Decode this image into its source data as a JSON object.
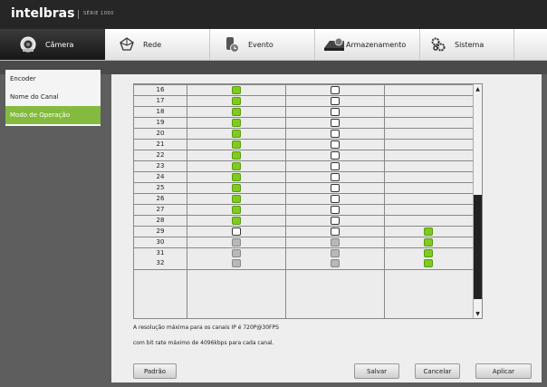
{
  "header": {
    "brand": "intelbras",
    "series": "SÉRIE 1000"
  },
  "tabs": [
    {
      "label": "Câmera",
      "icon": "camera-icon",
      "active": true
    },
    {
      "label": "Rede",
      "icon": "network-icon",
      "active": false
    },
    {
      "label": "Evento",
      "icon": "event-icon",
      "active": false
    },
    {
      "label": "Armazenamento",
      "icon": "storage-icon",
      "active": false
    },
    {
      "label": "Sistema",
      "icon": "system-gears-icon",
      "active": false
    }
  ],
  "sidebar": {
    "items": [
      {
        "label": "Encoder",
        "active": false
      },
      {
        "label": "Nome do Canal",
        "active": false
      },
      {
        "label": "Modo de Operação",
        "active": true
      }
    ]
  },
  "channel_rows": [
    {
      "channel": "16",
      "col1": "green",
      "col2": "white",
      "col3": "none"
    },
    {
      "channel": "17",
      "col1": "green",
      "col2": "white",
      "col3": "none"
    },
    {
      "channel": "18",
      "col1": "green",
      "col2": "white",
      "col3": "none"
    },
    {
      "channel": "19",
      "col1": "green",
      "col2": "white",
      "col3": "none"
    },
    {
      "channel": "20",
      "col1": "green",
      "col2": "white",
      "col3": "none"
    },
    {
      "channel": "21",
      "col1": "green",
      "col2": "white",
      "col3": "none"
    },
    {
      "channel": "22",
      "col1": "green",
      "col2": "white",
      "col3": "none"
    },
    {
      "channel": "23",
      "col1": "green",
      "col2": "white",
      "col3": "none"
    },
    {
      "channel": "24",
      "col1": "green",
      "col2": "white",
      "col3": "none"
    },
    {
      "channel": "25",
      "col1": "green",
      "col2": "white",
      "col3": "none"
    },
    {
      "channel": "26",
      "col1": "green",
      "col2": "white",
      "col3": "none"
    },
    {
      "channel": "27",
      "col1": "green",
      "col2": "white",
      "col3": "none"
    },
    {
      "channel": "28",
      "col1": "green",
      "col2": "white",
      "col3": "none"
    },
    {
      "channel": "29",
      "col1": "white",
      "col2": "white",
      "col3": "green"
    },
    {
      "channel": "30",
      "col1": "gray",
      "col2": "gray",
      "col3": "green"
    },
    {
      "channel": "31",
      "col1": "gray",
      "col2": "gray",
      "col3": "green"
    },
    {
      "channel": "32",
      "col1": "gray",
      "col2": "gray",
      "col3": "green"
    }
  ],
  "notes": {
    "line1": "A resolução máxima para os canais IP é 720P@30FPS",
    "line2": "com bit rate máximo de 4096kbps para cada canal."
  },
  "buttons": {
    "default": "Padrão",
    "save": "Salvar",
    "cancel": "Cancelar",
    "apply": "Aplicar"
  },
  "colors": {
    "accent_green": "#84bb3e",
    "checkbox_green": "#7fcc1e",
    "topbar": "#262626"
  }
}
